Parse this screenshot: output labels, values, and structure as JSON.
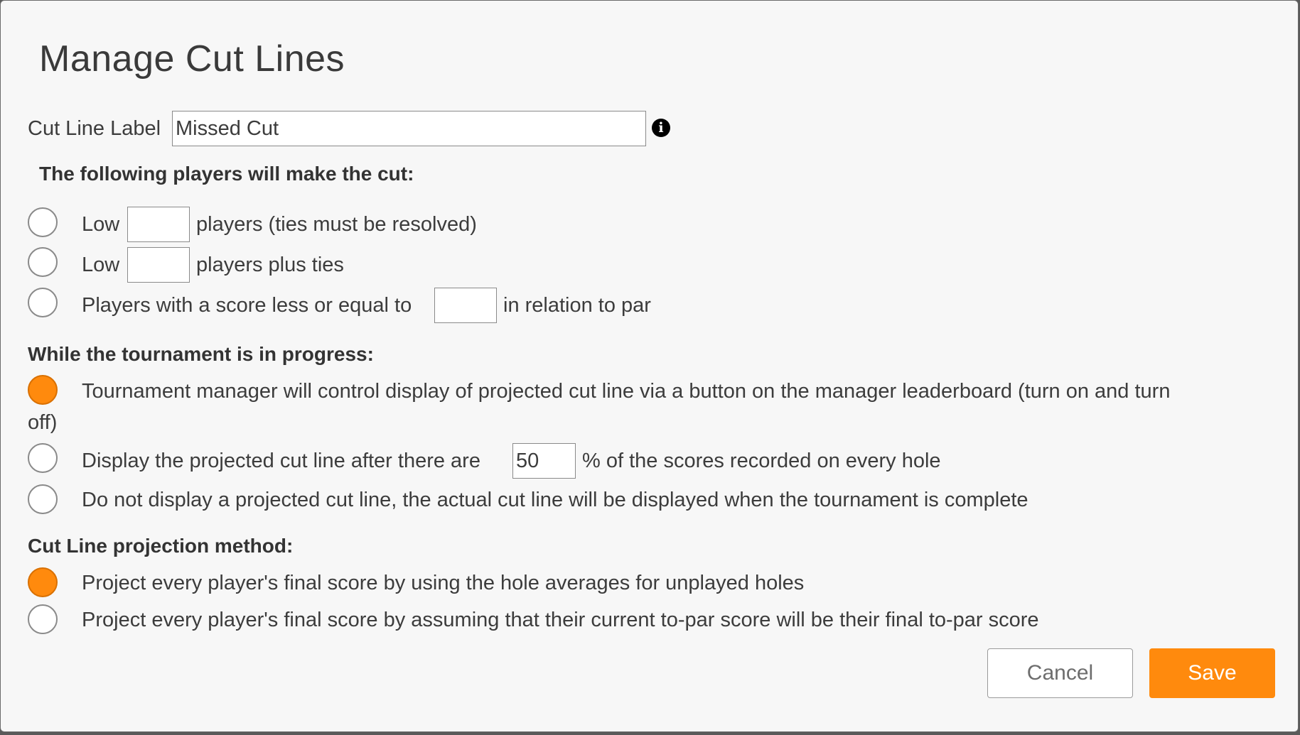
{
  "dialog": {
    "title": "Manage Cut Lines"
  },
  "label_field": {
    "label": "Cut Line Label",
    "value": "Missed Cut"
  },
  "make_cut": {
    "heading": "The following players will make the cut:",
    "options": [
      {
        "prefix": "Low",
        "value": "",
        "suffix": "players (ties must be resolved)",
        "checked": false
      },
      {
        "prefix": "Low",
        "value": "",
        "suffix": "players plus ties",
        "checked": false
      },
      {
        "prefix": "Players with a score less or equal to",
        "value": "",
        "suffix": "in relation to par",
        "checked": false
      }
    ]
  },
  "in_progress": {
    "heading": "While the tournament is in progress:",
    "option1_line1": "Tournament manager will control display of projected cut line via a button on the manager leaderboard (turn on and turn",
    "option1_line2": "off)",
    "option2_prefix": "Display the projected cut line after there are",
    "option2_value": "50",
    "option2_suffix": "% of the scores recorded on every hole",
    "option3": "Do not display a projected cut line, the actual cut line will be displayed when the tournament is complete",
    "selected_index": 0
  },
  "projection": {
    "heading": "Cut Line projection method:",
    "options": [
      "Project every player's final score by using the hole averages for unplayed holes",
      "Project every player's final score by assuming that their current to-par score will be their final to-par score"
    ],
    "selected_index": 0
  },
  "buttons": {
    "cancel": "Cancel",
    "save": "Save"
  },
  "colors": {
    "accent": "#ff8a0d",
    "background": "#f7f7f7"
  },
  "icons": {
    "info": "info-icon"
  }
}
